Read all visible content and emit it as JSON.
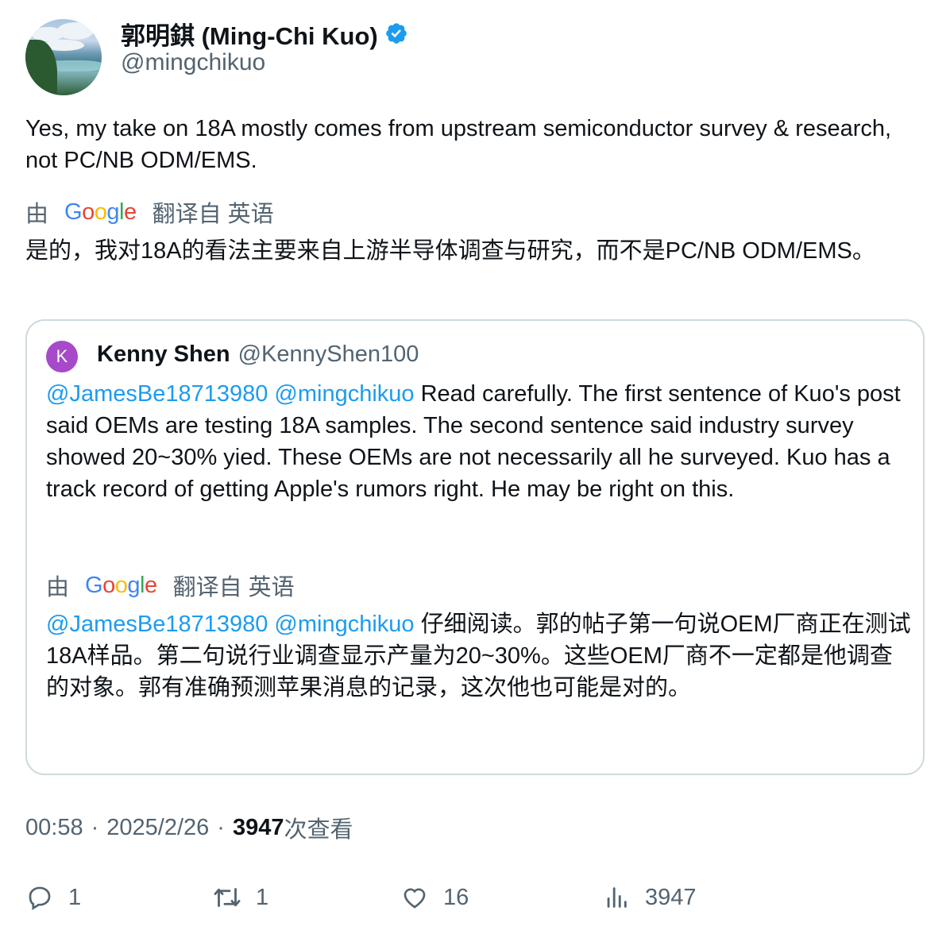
{
  "author": {
    "display_name": "郭明錤 (Ming-Chi Kuo)",
    "handle": "@mingchikuo",
    "verified": true
  },
  "tweet": {
    "text": "Yes, my take on 18A mostly comes from upstream semiconductor survey & research, not PC/NB ODM/EMS.",
    "translated_by_prefix": "由",
    "translated_by_brand": "Google",
    "translated_by_suffix": "翻译自 英语",
    "translation": "是的，我对18A的看法主要来自上游半导体调查与研究，而不是PC/NB ODM/EMS。"
  },
  "quote": {
    "avatar_letter": "K",
    "display_name": "Kenny Shen",
    "handle": "@KennyShen100",
    "mention_1": "@JamesBe18713980",
    "mention_2": "@mingchikuo",
    "text": "Read carefully. The first sentence of Kuo's post said OEMs are testing 18A samples. The second sentence said industry survey showed 20~30% yied. These OEMs are not necessarily all he surveyed. Kuo has a track record of getting Apple's rumors right. He may be right on this.",
    "translated_by_prefix": "由",
    "translated_by_brand": "Google",
    "translated_by_suffix": "翻译自 英语",
    "translation": "仔细阅读。郭的帖子第一句说OEM厂商正在测试18A样品。第二句说行业调查显示产量为20~30%。这些OEM厂商不一定都是他调查的对象。郭有准确预测苹果消息的记录，这次他也可能是对的。"
  },
  "meta": {
    "time": "00:58",
    "separator": "·",
    "date": "2025/2/26",
    "views_count": "3947",
    "views_label": "次查看"
  },
  "actions": {
    "replies": "1",
    "retweets": "1",
    "likes": "16",
    "views": "3947"
  },
  "colors": {
    "accent": "#1d9bf0",
    "secondary_text": "#536471",
    "quote_avatar": "#a64ac9",
    "border": "#cfd9de"
  },
  "icons": [
    "verified-badge-icon",
    "google-logo",
    "reply-icon",
    "retweet-icon",
    "like-icon",
    "views-icon"
  ]
}
